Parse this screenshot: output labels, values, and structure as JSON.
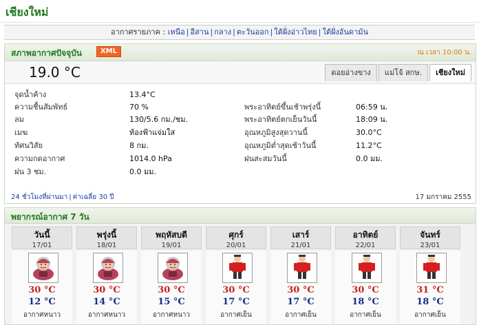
{
  "page": {
    "title": "เชียงใหม่"
  },
  "regions": {
    "label": "อากาศรายภาค :",
    "items": [
      "เหนือ",
      "อีสาน",
      "กลาง",
      "ตะวันออก",
      "ใต้ฝั่งอ่าวไทย",
      "ใต้ฝั่งอันดามัน"
    ]
  },
  "current": {
    "title": "สภาพอากาศปัจจุบัน",
    "xml_label": "XML",
    "update_time": "ณ เวลา 10:00 น.",
    "temperature": "19.0 °C",
    "tabs": [
      {
        "label": "ดอยอ่างขาง",
        "active": false
      },
      {
        "label": "แม่โจ้ สกษ.",
        "active": false
      },
      {
        "label": "เชียงใหม่",
        "active": true
      }
    ],
    "left": [
      {
        "label": "จุดน้ำค้าง",
        "value": "13.4°C"
      },
      {
        "label": "ความชื้นสัมพัทธ์",
        "value": "70 %"
      },
      {
        "label": "ลม",
        "value": "130/5.6 กม./ชม."
      },
      {
        "label": "เมฆ",
        "value": "ท้องฟ้าแจ่มใส"
      },
      {
        "label": "ทัศนวิสัย",
        "value": "8 กม."
      },
      {
        "label": "ความกดอากาศ",
        "value": "1014.0 hPa"
      },
      {
        "label": "ฝน 3 ชม.",
        "value": "0.0 มม."
      }
    ],
    "right": [
      {
        "label": "พระอาทิตย์ขึ้นเช้าพรุ่งนี้",
        "value": "06:59 น."
      },
      {
        "label": "พระอาทิตย์ตกเย็นวันนี้",
        "value": "18:09 น."
      },
      {
        "label": "อุณหภูมิสูงสุดวานนี้",
        "value": "30.0°C"
      },
      {
        "label": "อุณหภูมิต่ำสุดเช้าวันนี้",
        "value": "11.2°C"
      },
      {
        "label": "ฝนสะสมวันนี้",
        "value": "0.0 มม."
      }
    ],
    "links": [
      "24 ชั่วโมงที่ผ่านมา",
      "ค่าเฉลี่ย 30 ปี"
    ],
    "date": "17 มกราคม 2555"
  },
  "forecast": {
    "title": "พยากรณ์อากาศ 7 วัน",
    "days": [
      {
        "day": "วันนี้",
        "date": "17/01",
        "high": "30 °C",
        "low": "12 °C",
        "condition": "อากาศหนาว",
        "icon": "cold-grandma-icon"
      },
      {
        "day": "พรุ่งนี้",
        "date": "18/01",
        "high": "30 °C",
        "low": "14 °C",
        "condition": "อากาศหนาว",
        "icon": "cold-grandma-icon"
      },
      {
        "day": "พฤหัสบดี",
        "date": "19/01",
        "high": "30 °C",
        "low": "15 °C",
        "condition": "อากาศหนาว",
        "icon": "cold-grandma-icon"
      },
      {
        "day": "ศุกร์",
        "date": "20/01",
        "high": "30 °C",
        "low": "17 °C",
        "condition": "อากาศเย็น",
        "icon": "cool-man-icon"
      },
      {
        "day": "เสาร์",
        "date": "21/01",
        "high": "30 °C",
        "low": "17 °C",
        "condition": "อากาศเย็น",
        "icon": "cool-man-icon"
      },
      {
        "day": "อาทิตย์",
        "date": "22/01",
        "high": "30 °C",
        "low": "18 °C",
        "condition": "อากาศเย็น",
        "icon": "cool-man-icon"
      },
      {
        "day": "จันทร์",
        "date": "23/01",
        "high": "31 °C",
        "low": "18 °C",
        "condition": "อากาศเย็น",
        "icon": "cool-man-icon"
      }
    ]
  },
  "colors": {
    "brand_green": "#1e7a1e",
    "link_blue": "#1a3fa0",
    "high_red": "#c62020",
    "low_blue": "#1a2a8a",
    "badge_orange": "#f26522"
  }
}
